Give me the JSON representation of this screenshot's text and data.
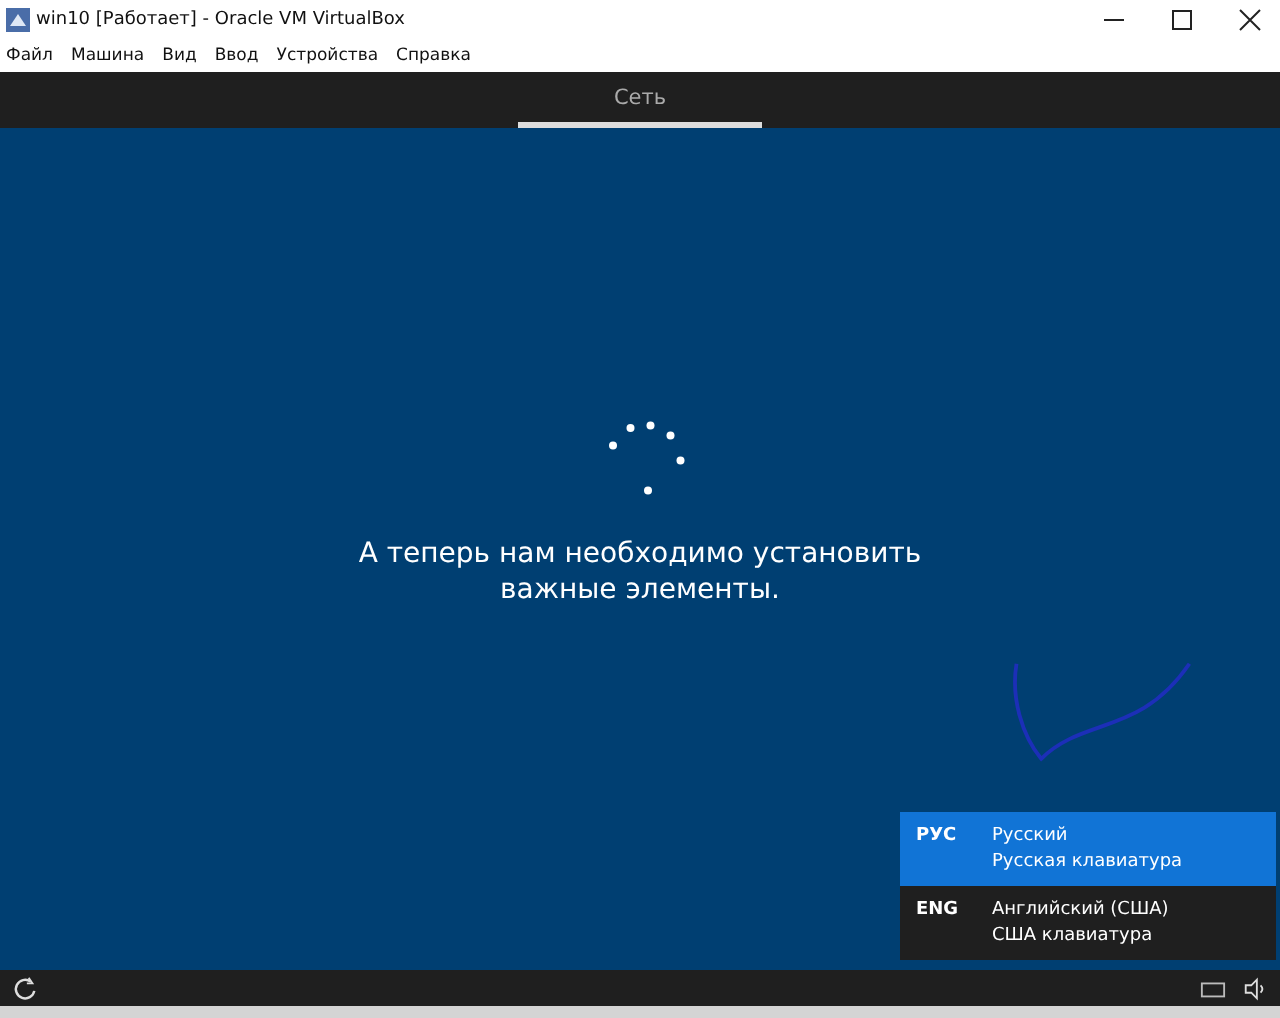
{
  "window": {
    "title": "win10 [Работает] - Oracle VM VirtualBox"
  },
  "menu": [
    "Файл",
    "Машина",
    "Вид",
    "Ввод",
    "Устройства",
    "Справка"
  ],
  "tabs": [
    {
      "label": "Сеть",
      "selected": true
    }
  ],
  "message": "А теперь нам необходимо установить важные элементы.",
  "language_menu": [
    {
      "code": "РУС",
      "name": "Русский",
      "keyboard": "Русская клавиатура",
      "selected": true
    },
    {
      "code": "ENG",
      "name": "Английский (США)",
      "keyboard": "США клавиатура",
      "selected": false
    }
  ]
}
